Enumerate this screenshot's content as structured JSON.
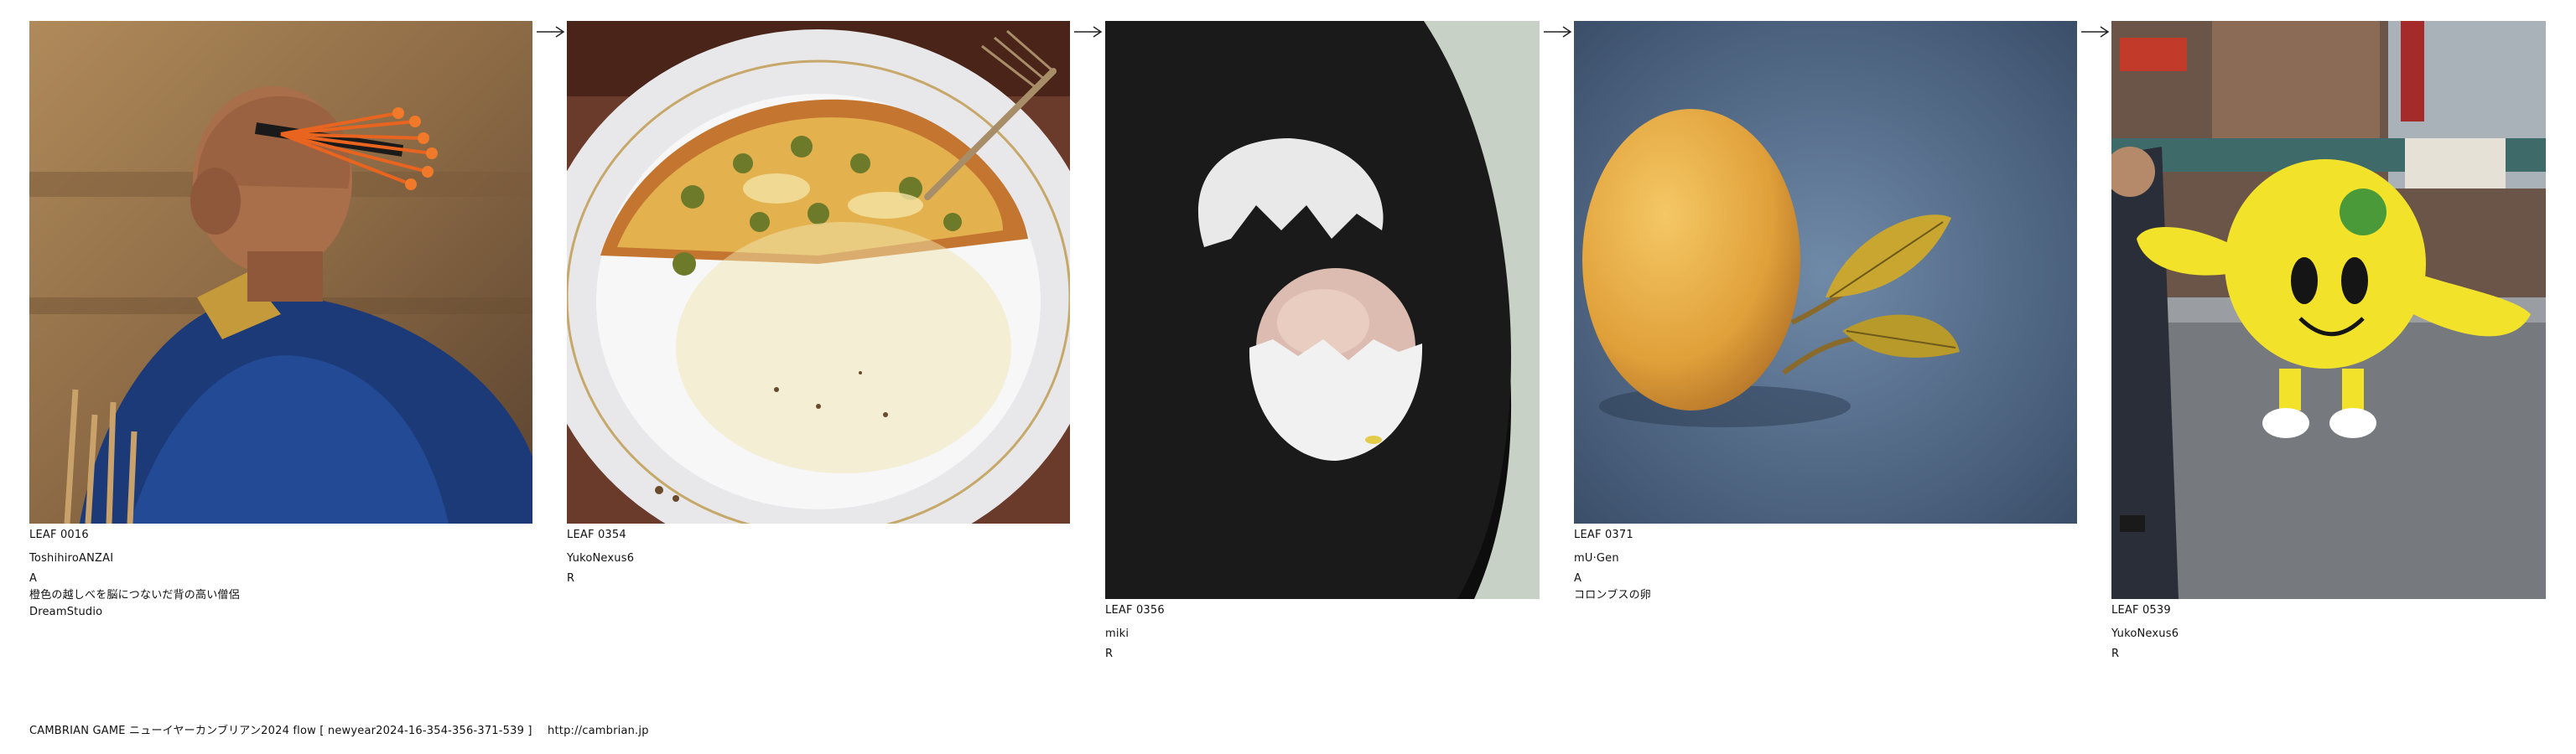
{
  "leaves": [
    {
      "id": "LEAF 0016",
      "author": "ToshihiroANZAI",
      "extra": [
        "A",
        "橙色の越しべを脳につないだ背の高い僧侶",
        "DreamStudio"
      ],
      "image_subject": "monk-with-orange-stamen"
    },
    {
      "id": "LEAF 0354",
      "author": "YukoNexus6",
      "extra": [
        "R"
      ],
      "image_subject": "half-eaten-pizza-plate"
    },
    {
      "id": "LEAF 0356",
      "author": "miki",
      "extra": [
        "R"
      ],
      "image_subject": "cracked-egg-on-black-tray"
    },
    {
      "id": "LEAF 0371",
      "author": "mU·Gen",
      "extra": [
        "A",
        "コロンブスの卵"
      ],
      "image_subject": "yellow-egg-with-leaves"
    },
    {
      "id": "LEAF 0539",
      "author": "YukoNexus6",
      "extra": [
        "R"
      ],
      "image_subject": "yellow-mascot-on-street"
    }
  ],
  "footer": {
    "title": "CAMBRIAN GAME  ニューイヤーカンブリアン2024  flow [ newyear2024-16-354-356-371-539 ]",
    "url": "http://cambrian.jp"
  },
  "colors": {
    "text": "#111111",
    "background": "#ffffff"
  }
}
